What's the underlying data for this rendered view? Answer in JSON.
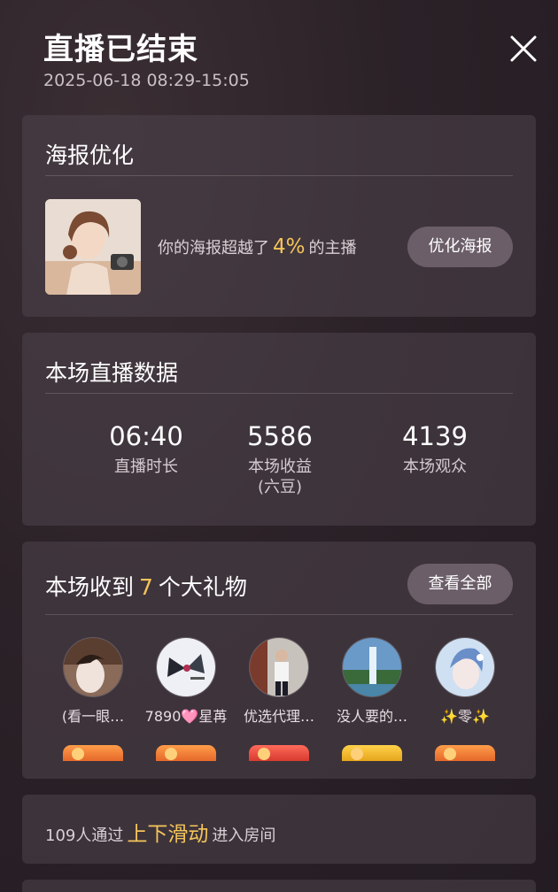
{
  "header": {
    "title": "直播已结束",
    "time_range": "2025-06-18 08:29-15:05",
    "close_icon": "close-icon"
  },
  "poster": {
    "section_title": "海报优化",
    "text_before": "你的海报超越了",
    "percent": "4%",
    "text_after": "的主播",
    "button_label": "优化海报"
  },
  "stats": {
    "section_title": "本场直播数据",
    "items": [
      {
        "value": "06:40",
        "label": "直播时长"
      },
      {
        "value": "5586",
        "label": "本场收益\n(六豆)"
      },
      {
        "value": "4139",
        "label": "本场观众"
      }
    ]
  },
  "gifts": {
    "title_before": "本场收到",
    "count": "7",
    "title_after": "个大礼物",
    "view_all_label": "查看全部",
    "gifters": [
      {
        "name": "(看一眼…"
      },
      {
        "name": "7890🩷星苒"
      },
      {
        "name": "优选代理…"
      },
      {
        "name": "没人要的…"
      },
      {
        "name": "✨零✨"
      }
    ]
  },
  "enter": {
    "text_before": "109人通过",
    "highlight": "上下滑动",
    "text_after": "进入房间"
  },
  "colors": {
    "accent": "#f5c45a",
    "button_bg": "#6b5e68",
    "card_bg": "#4e444c"
  }
}
